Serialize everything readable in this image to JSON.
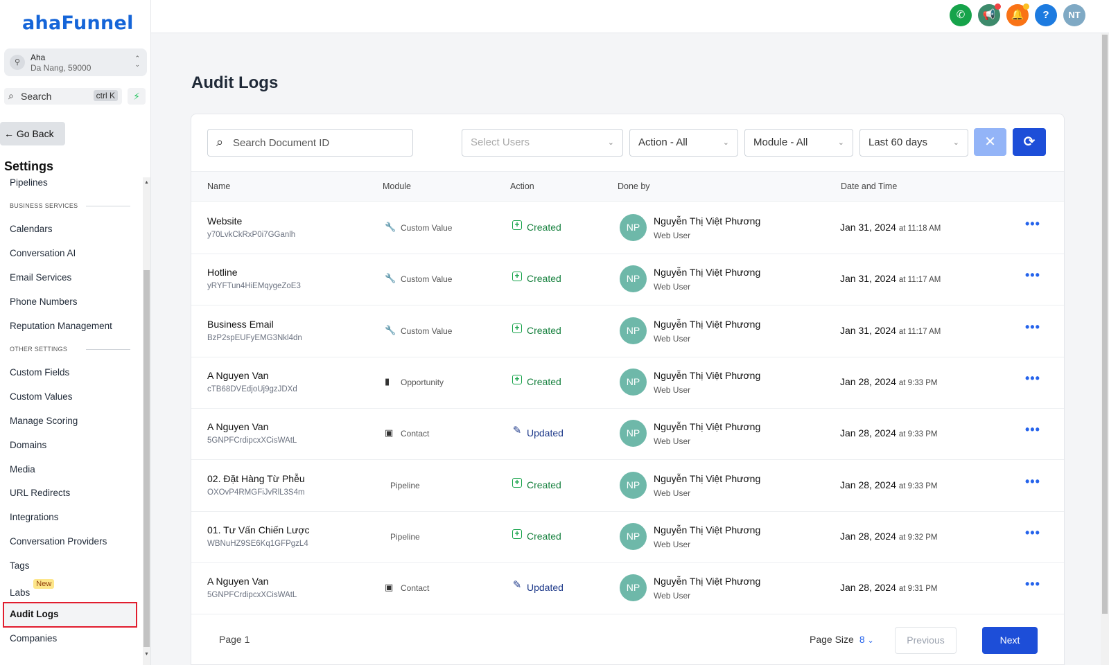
{
  "app": {
    "logo": "ahaFunnel"
  },
  "account": {
    "name": "Aha",
    "location": "Da Nang, 59000"
  },
  "sidebar_search": {
    "label": "Search",
    "shortcut": "ctrl K"
  },
  "go_back": "← Go Back",
  "settings_title": "Settings",
  "nav": {
    "pipelines": "Pipelines",
    "section_business": "BUSINESS SERVICES",
    "calendars": "Calendars",
    "conversation_ai": "Conversation AI",
    "email_services": "Email Services",
    "phone_numbers": "Phone Numbers",
    "reputation": "Reputation Management",
    "section_other": "OTHER SETTINGS",
    "custom_fields": "Custom Fields",
    "custom_values": "Custom Values",
    "manage_scoring": "Manage Scoring",
    "domains": "Domains",
    "media": "Media",
    "url_redirects": "URL Redirects",
    "integrations": "Integrations",
    "conversation_providers": "Conversation Providers",
    "tags": "Tags",
    "labs": "Labs",
    "labs_badge": "New",
    "audit_logs": "Audit Logs",
    "companies": "Companies"
  },
  "topbar": {
    "user_initials": "NT",
    "help": "?"
  },
  "page": {
    "title": "Audit Logs"
  },
  "filters": {
    "search_placeholder": "Search Document ID",
    "users": "Select Users",
    "action": "Action - All",
    "module": "Module - All",
    "date_range": "Last 60 days"
  },
  "table": {
    "headers": {
      "name": "Name",
      "module": "Module",
      "action": "Action",
      "done_by": "Done by",
      "date": "Date and Time"
    },
    "rows": [
      {
        "name": "Website",
        "id": "y70LvkCkRxP0i7GGanlh",
        "module": "Custom Value",
        "action": "Created",
        "initials": "NP",
        "user": "Nguyễn Thị Việt Phương",
        "role": "Web User",
        "date": "Jan 31, 2024",
        "time": "at 11:18 AM"
      },
      {
        "name": "Hotline",
        "id": "yRYFTun4HiEMqygeZoE3",
        "module": "Custom Value",
        "action": "Created",
        "initials": "NP",
        "user": "Nguyễn Thị Việt Phương",
        "role": "Web User",
        "date": "Jan 31, 2024",
        "time": "at 11:17 AM"
      },
      {
        "name": "Business Email",
        "id": "BzP2spEUFyEMG3Nkl4dn",
        "module": "Custom Value",
        "action": "Created",
        "initials": "NP",
        "user": "Nguyễn Thị Việt Phương",
        "role": "Web User",
        "date": "Jan 31, 2024",
        "time": "at 11:17 AM"
      },
      {
        "name": "A Nguyen Van",
        "id": "cTB68DVEdjoUj9gzJDXd",
        "module": "Opportunity",
        "action": "Created",
        "initials": "NP",
        "user": "Nguyễn Thị Việt Phương",
        "role": "Web User",
        "date": "Jan 28, 2024",
        "time": "at 9:33 PM"
      },
      {
        "name": "A Nguyen Van",
        "id": "5GNPFCrdipcxXCisWAtL",
        "module": "Contact",
        "action": "Updated",
        "initials": "NP",
        "user": "Nguyễn Thị Việt Phương",
        "role": "Web User",
        "date": "Jan 28, 2024",
        "time": "at 9:33 PM"
      },
      {
        "name": "02. Đặt Hàng Từ Phễu",
        "id": "OXOvP4RMGFiJvRlL3S4m",
        "module": "Pipeline",
        "action": "Created",
        "initials": "NP",
        "user": "Nguyễn Thị Việt Phương",
        "role": "Web User",
        "date": "Jan 28, 2024",
        "time": "at 9:33 PM"
      },
      {
        "name": "01. Tư Vấn Chiến Lược",
        "id": "WBNuHZ9SE6Kq1GFPgzL4",
        "module": "Pipeline",
        "action": "Created",
        "initials": "NP",
        "user": "Nguyễn Thị Việt Phương",
        "role": "Web User",
        "date": "Jan 28, 2024",
        "time": "at 9:32 PM"
      },
      {
        "name": "A Nguyen Van",
        "id": "5GNPFCrdipcxXCisWAtL",
        "module": "Contact",
        "action": "Updated",
        "initials": "NP",
        "user": "Nguyễn Thị Việt Phương",
        "role": "Web User",
        "date": "Jan 28, 2024",
        "time": "at 9:31 PM"
      }
    ]
  },
  "pagination": {
    "page_label": "Page 1",
    "size_label": "Page Size",
    "size_value": "8",
    "prev": "Previous",
    "next": "Next"
  }
}
